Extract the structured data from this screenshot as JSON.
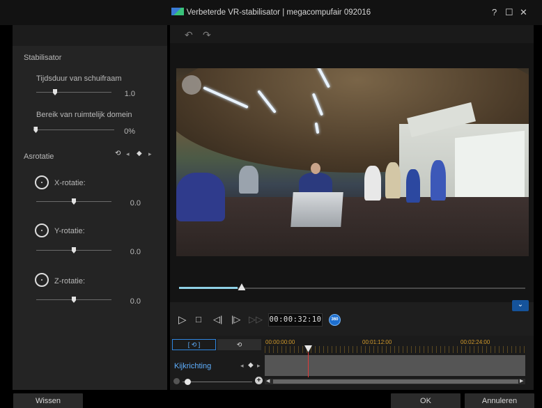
{
  "window": {
    "title": "Verbeterde VR-stabilisator | megacompufair 092016",
    "help": "?",
    "maximize": "☐",
    "close": "✕"
  },
  "left_panel": {
    "section_stabilizer": "Stabilisator",
    "sliding_frame": {
      "label": "Tijdsduur van schuifraam",
      "value": "1.0",
      "level": 0.2
    },
    "spatial_range": {
      "label": "Bereik van ruimtelijk domein",
      "value": "0%",
      "level": 0.0
    },
    "section_axis": "Asrotatie",
    "x_rotation": {
      "label": "X-rotatie:",
      "value": "0.0",
      "level": 0.5
    },
    "y_rotation": {
      "label": "Y-rotatie:",
      "value": "0.0",
      "level": 0.5
    },
    "z_rotation": {
      "label": "Z-rotatie:",
      "value": "0.0",
      "level": 0.5
    }
  },
  "toolbar": {
    "undo": "↶",
    "redo": "↷"
  },
  "player": {
    "progress": 0.17,
    "timecode": "00:00:32:10",
    "badge_360": "360",
    "collapse": "⌄"
  },
  "timeline": {
    "tab_a": "[ ⟲ ]",
    "tab_b": "⟲",
    "ruler_times": [
      "00:00:00:00",
      "00:01:12:00",
      "00:02:24:00"
    ],
    "track_label": "Kijkrichting"
  },
  "footer": {
    "clear": "Wissen",
    "ok": "OK",
    "cancel": "Annuleren"
  },
  "colors": {
    "accent": "#2f86e0",
    "progress": "#8fd1e6",
    "playhead": "#e23a3a",
    "ruler_text": "#d39b2c"
  }
}
